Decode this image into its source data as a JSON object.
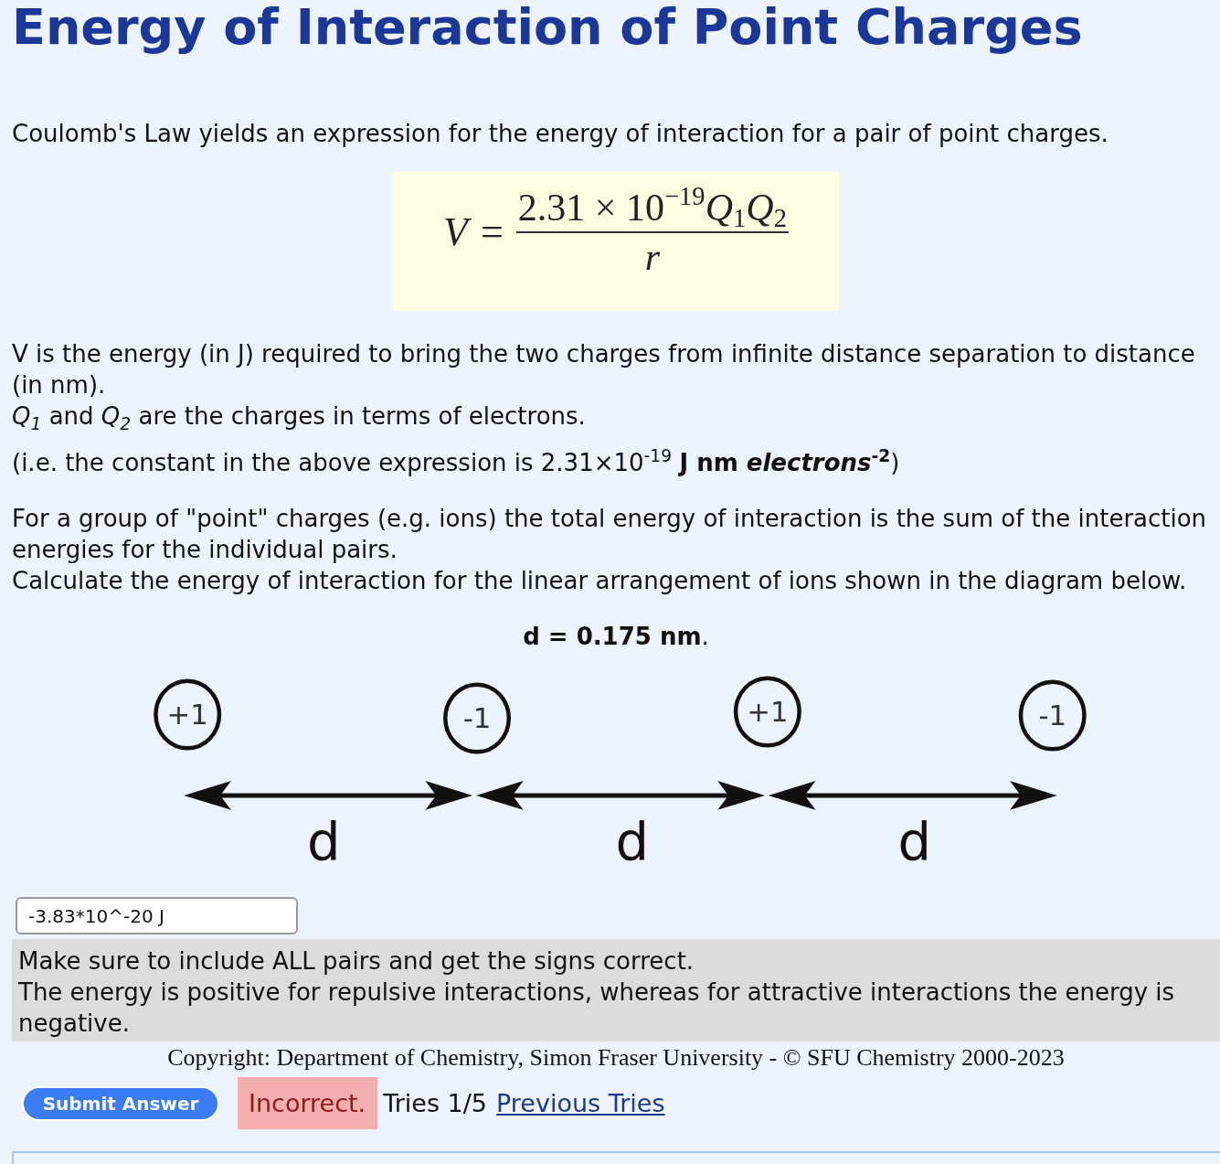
{
  "title": "Energy of Interaction of Point Charges",
  "intro": "Coulomb's Law yields an expression for the energy of interaction for a pair of point charges.",
  "formula": {
    "lhs": "V",
    "relation": "=",
    "numerator": "2.31 × 10$^{−19}$*Q*$_{1}$*Q*$_{2}$",
    "denominator": "r"
  },
  "definitions": [
    {
      "lines": [
        "V is the energy (in J) required to bring the two charges from infinite distance separation to distance",
        "(in nm)."
      ]
    },
    {
      "lines": [
        "*Q*$_{1}$ and *Q*$_{2}$ are the charges in terms of electrons."
      ]
    }
  ],
  "constant_note": "(i.e. the constant in the above expression is 2.31×10$^{-19}$ **J nm *electrons*$^{-2}$**)",
  "problem": [
    {
      "lines": [
        "For a group of \"point\" charges (e.g. ions) the total energy of interaction is the sum of the interaction",
        "energies for the individual pairs."
      ]
    },
    {
      "lines": [
        "Calculate the energy of interaction for the linear arrangement of ions shown in the diagram below."
      ]
    }
  ],
  "given": "**d = 0.175 nm**.",
  "diagram": {
    "charges": [
      {
        "label": "+1"
      },
      {
        "label": "-1"
      },
      {
        "label": "+1"
      },
      {
        "label": "-1"
      }
    ],
    "spacings": [
      {
        "label": "d"
      },
      {
        "label": "d"
      },
      {
        "label": "d"
      }
    ]
  },
  "answer_field": {
    "value": "-3.83*10^-20 J"
  },
  "feedback": [
    "Make sure to include ALL pairs and get the signs correct.",
    "The energy is positive for repulsive interactions, whereas for attractive interactions the energy is negative."
  ],
  "copyright": "Copyright: Department of Chemistry, Simon Fraser University - © SFU Chemistry 2000-2023",
  "submit_button": "Submit Answer",
  "result": {
    "status": "Incorrect.",
    "correct": false
  },
  "tries": "Tries 1/5",
  "previous_tries_link": "Previous Tries"
}
